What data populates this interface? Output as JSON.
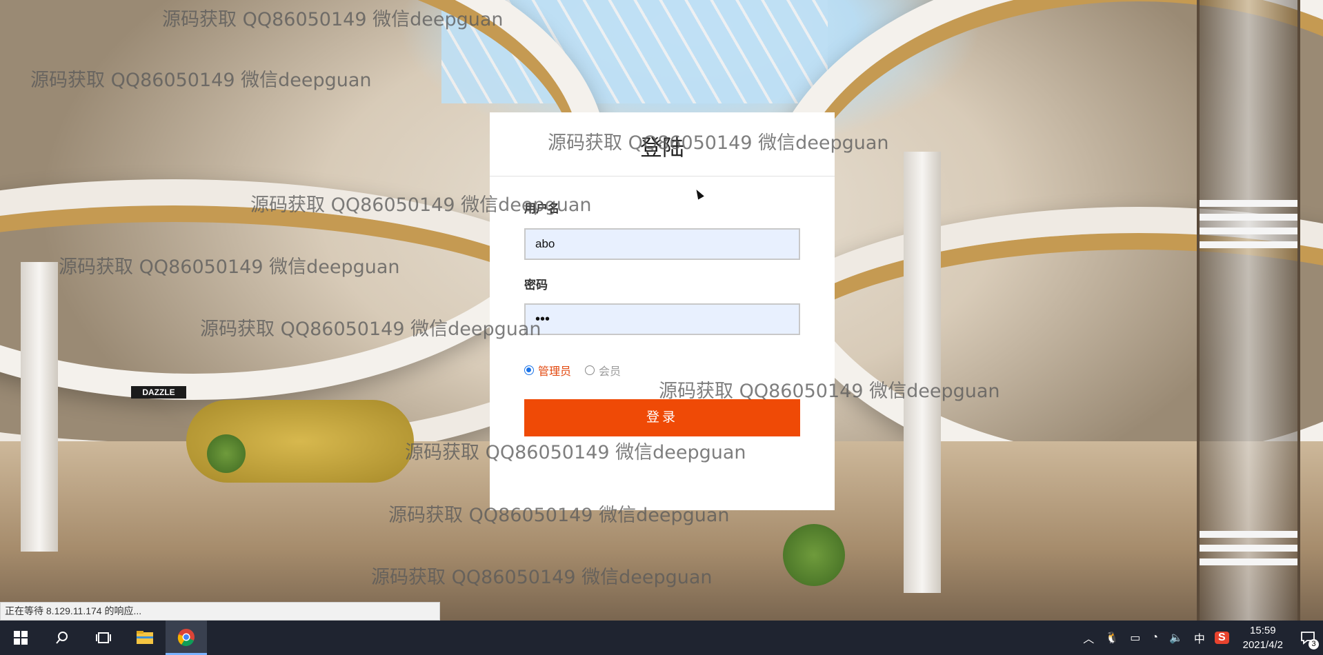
{
  "login": {
    "title": "登陆",
    "username_label": "用户名",
    "username_value": "abo",
    "password_label": "密码",
    "password_value": "•••",
    "roles": [
      {
        "label": "管理员",
        "selected": true
      },
      {
        "label": "会员",
        "selected": false
      }
    ],
    "submit_label": "登录"
  },
  "watermark": "源码获取 QQ86050149 微信deepguan",
  "browser_status": "正在等待 8.129.11.174 的响应...",
  "mall_sign": "DAZZLE",
  "taskbar": {
    "time": "15:59",
    "date": "2021/4/2",
    "ime": "中",
    "notification_count": "3",
    "active_app": "chrome-icon"
  },
  "colors": {
    "accent": "#ef4a06",
    "input_bg": "#e8f0fe",
    "taskbar_bg": "#1f2430"
  }
}
